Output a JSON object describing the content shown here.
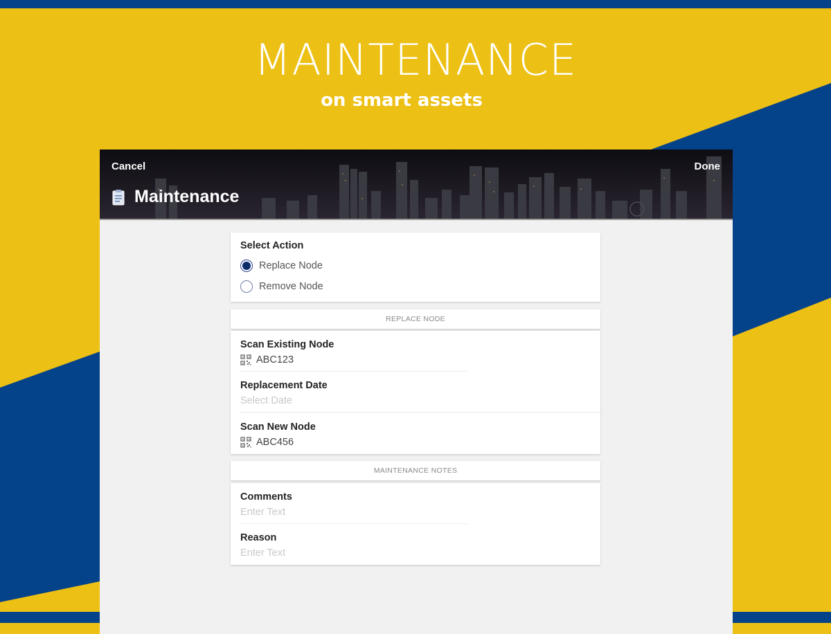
{
  "promo": {
    "title": "MAINTENANCE",
    "subtitle": "on smart assets"
  },
  "colors": {
    "yellow": "#ecc014",
    "blue": "#04428a",
    "radio_accent": "#0b2c6b",
    "header_bg": "#141419"
  },
  "header": {
    "cancel_label": "Cancel",
    "done_label": "Done",
    "title": "Maintenance",
    "title_icon": "clipboard-icon"
  },
  "select_action": {
    "label": "Select Action",
    "options": [
      {
        "label": "Replace Node",
        "selected": true
      },
      {
        "label": "Remove Node",
        "selected": false
      }
    ]
  },
  "replace_node": {
    "section_title": "REPLACE NODE",
    "fields": [
      {
        "label": "Scan Existing Node",
        "value": "ABC123",
        "icon": "qr-code-icon"
      },
      {
        "label": "Replacement Date",
        "placeholder": "Select Date"
      },
      {
        "label": "Scan New Node",
        "value": "ABC456",
        "icon": "qr-code-icon"
      }
    ]
  },
  "maintenance_notes": {
    "section_title": "MAINTENANCE NOTES",
    "fields": [
      {
        "label": "Comments",
        "placeholder": "Enter Text"
      },
      {
        "label": "Reason",
        "placeholder": "Enter Text"
      }
    ]
  }
}
